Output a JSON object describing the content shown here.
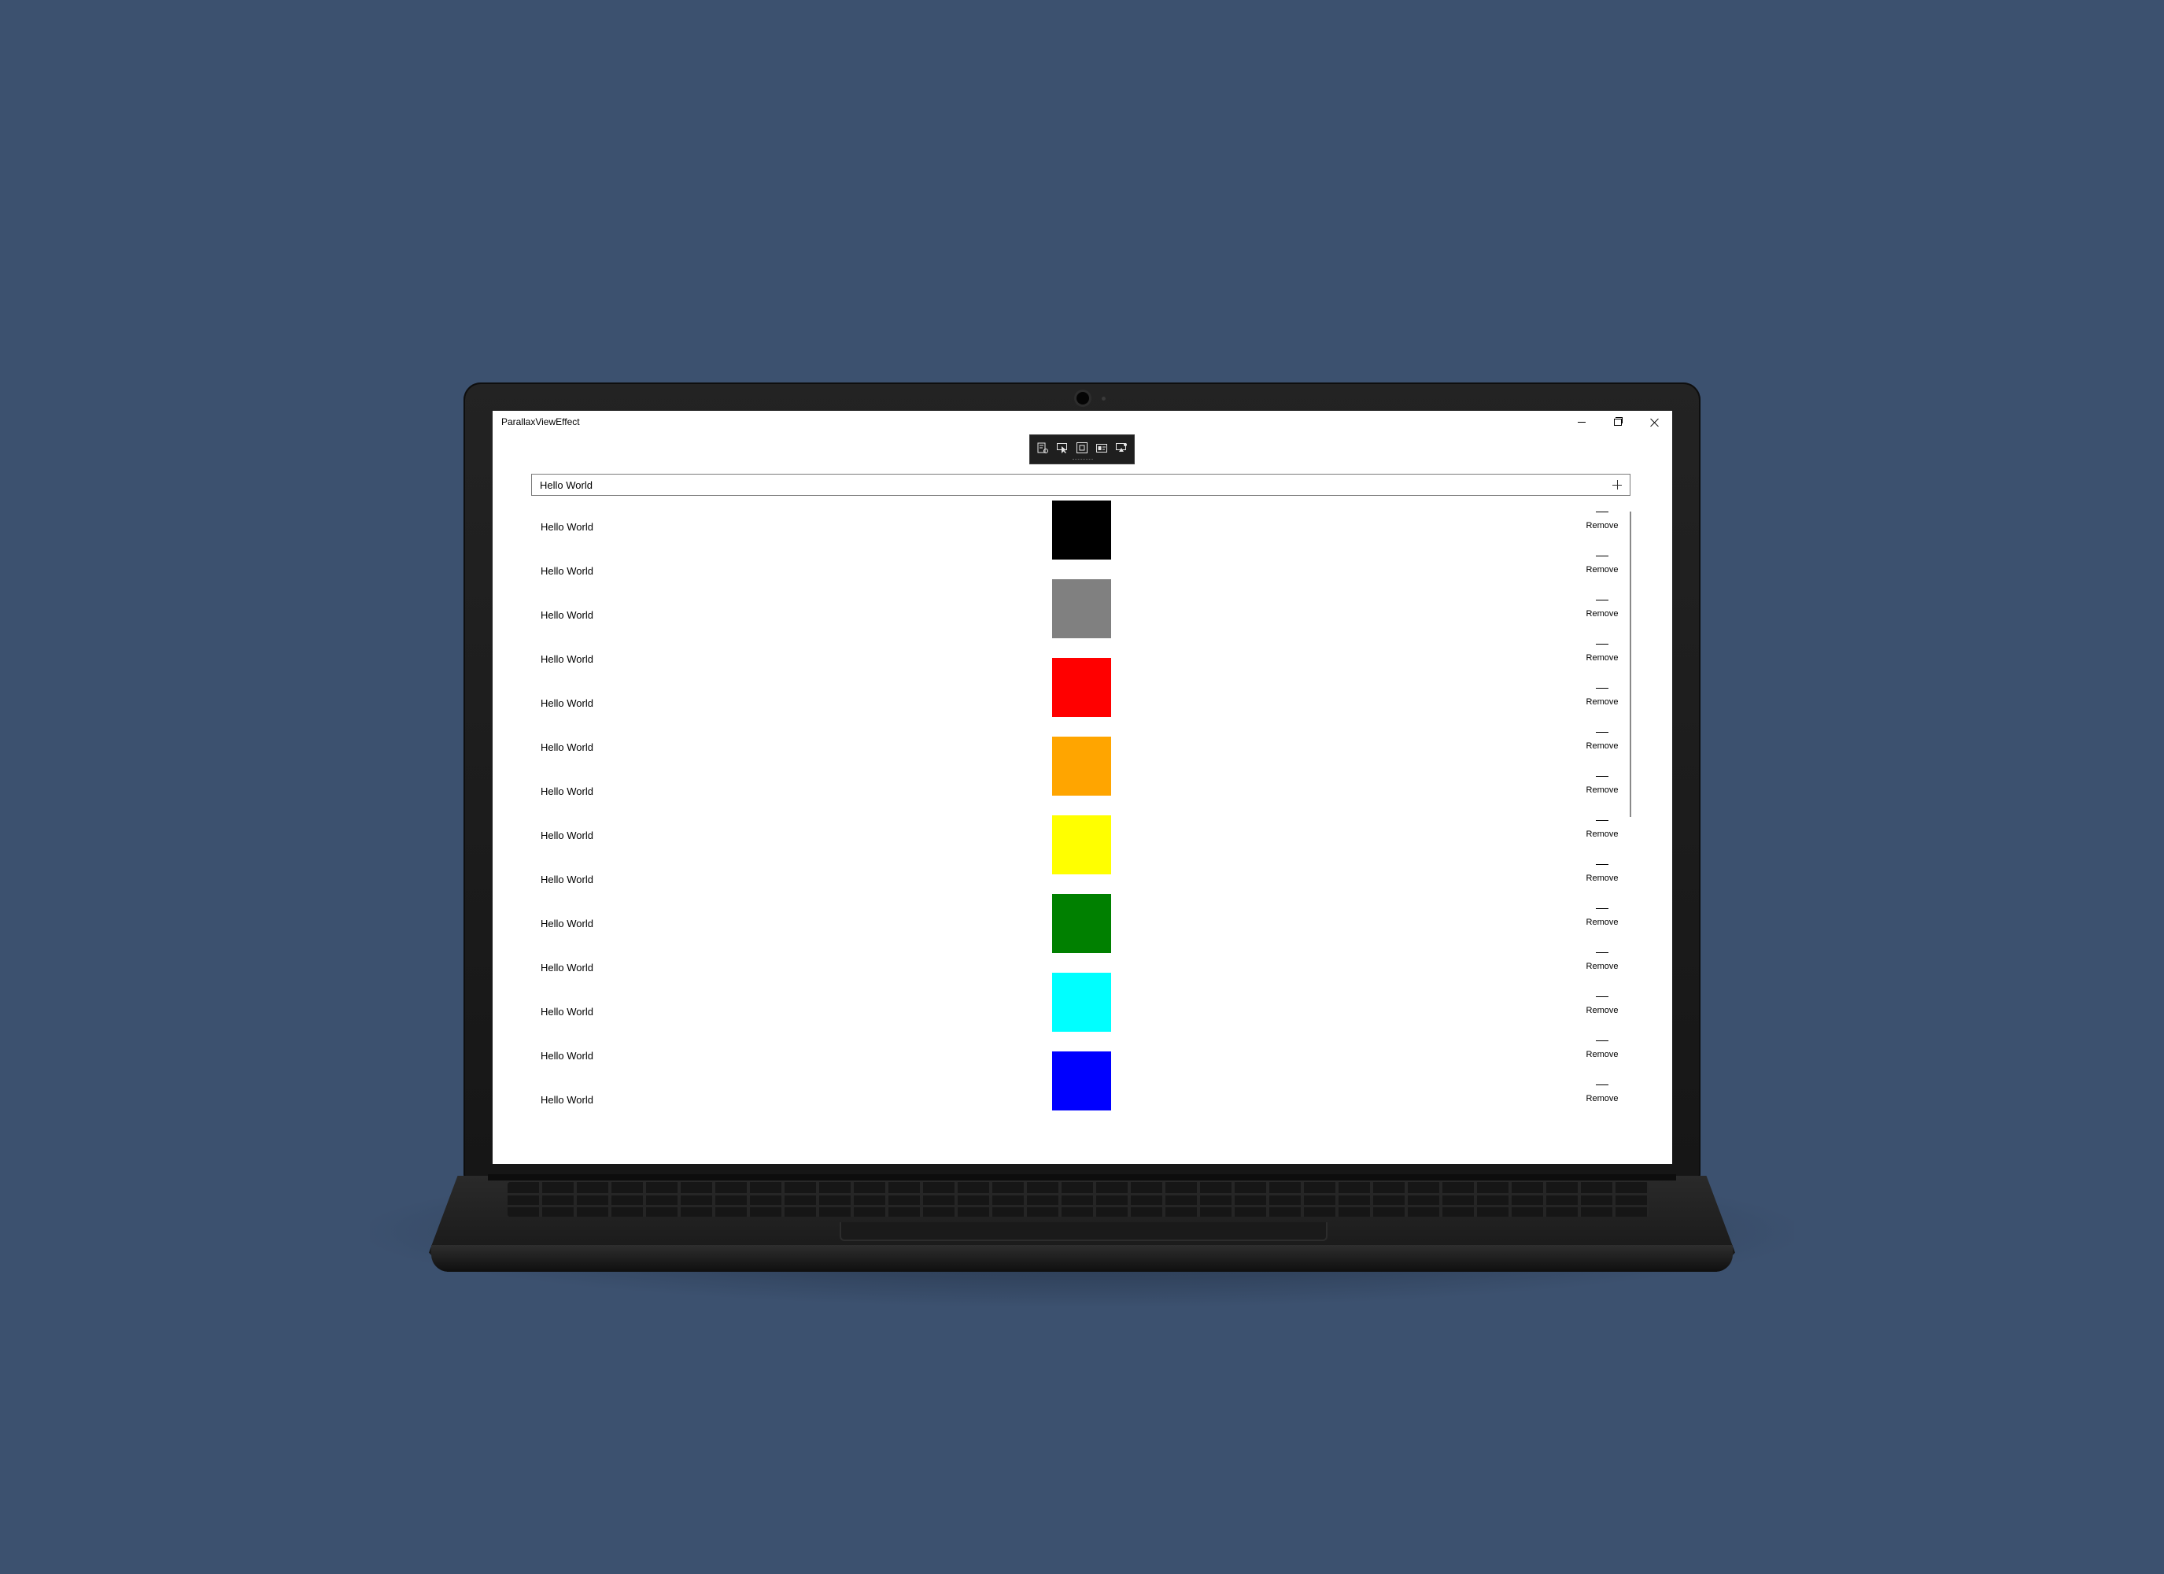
{
  "window": {
    "title": "ParallaxViewEffect"
  },
  "window_controls": [
    "minimize-icon",
    "restore-icon",
    "close-icon"
  ],
  "dev_toolbar": {
    "tools": [
      "live-visual-tree-icon",
      "select-element-icon",
      "display-layout-adorners-icon",
      "track-focus-icon",
      "hot-reload-icon"
    ]
  },
  "entry": {
    "value": "Hello World",
    "add_icon": "plus-icon"
  },
  "items": [
    {
      "label": "Hello World",
      "remove_label": "Remove"
    },
    {
      "label": "Hello World",
      "remove_label": "Remove"
    },
    {
      "label": "Hello World",
      "remove_label": "Remove"
    },
    {
      "label": "Hello World",
      "remove_label": "Remove"
    },
    {
      "label": "Hello World",
      "remove_label": "Remove"
    },
    {
      "label": "Hello World",
      "remove_label": "Remove"
    },
    {
      "label": "Hello World",
      "remove_label": "Remove"
    },
    {
      "label": "Hello World",
      "remove_label": "Remove"
    },
    {
      "label": "Hello World",
      "remove_label": "Remove"
    },
    {
      "label": "Hello World",
      "remove_label": "Remove"
    },
    {
      "label": "Hello World",
      "remove_label": "Remove"
    },
    {
      "label": "Hello World",
      "remove_label": "Remove"
    },
    {
      "label": "Hello World",
      "remove_label": "Remove"
    },
    {
      "label": "Hello World",
      "remove_label": "Remove"
    }
  ],
  "swatches": [
    "#000000",
    "#808080",
    "#ff0000",
    "#ffa500",
    "#ffff00",
    "#008000",
    "#00ffff",
    "#0000ff"
  ],
  "colors": {
    "background": "#3c516f",
    "window": "#ffffff",
    "laptop_body": "#1a1a1a"
  }
}
